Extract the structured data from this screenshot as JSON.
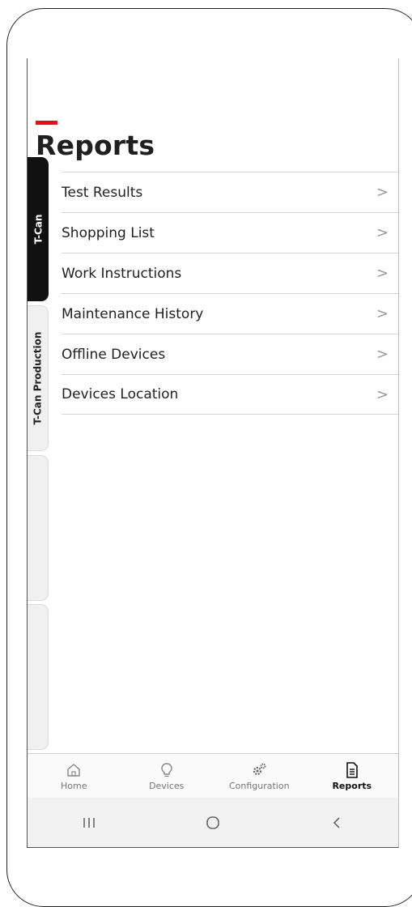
{
  "page": {
    "title": "Reports"
  },
  "side_tabs": [
    {
      "label": "T-Can",
      "active": true
    },
    {
      "label": "T-Can Production",
      "active": false
    },
    {
      "label": "",
      "active": false
    },
    {
      "label": "",
      "active": false
    }
  ],
  "reports": [
    {
      "label": "Test Results"
    },
    {
      "label": "Shopping List"
    },
    {
      "label": "Work Instructions"
    },
    {
      "label": "Maintenance History"
    },
    {
      "label": "Offline Devices"
    },
    {
      "label": "Devices Location"
    }
  ],
  "chevron": ">",
  "bottom_nav": [
    {
      "label": "Home",
      "icon": "home-icon"
    },
    {
      "label": "Devices",
      "icon": "lightbulb-icon"
    },
    {
      "label": "Configuration",
      "icon": "gears-icon"
    },
    {
      "label": "Reports",
      "icon": "document-icon",
      "active": true
    }
  ],
  "system_nav": [
    "recent-apps-icon",
    "home-circle-icon",
    "back-icon"
  ],
  "colors": {
    "accent": "#ff000f",
    "active_tab": "#111111",
    "text": "#1f1f1f"
  }
}
